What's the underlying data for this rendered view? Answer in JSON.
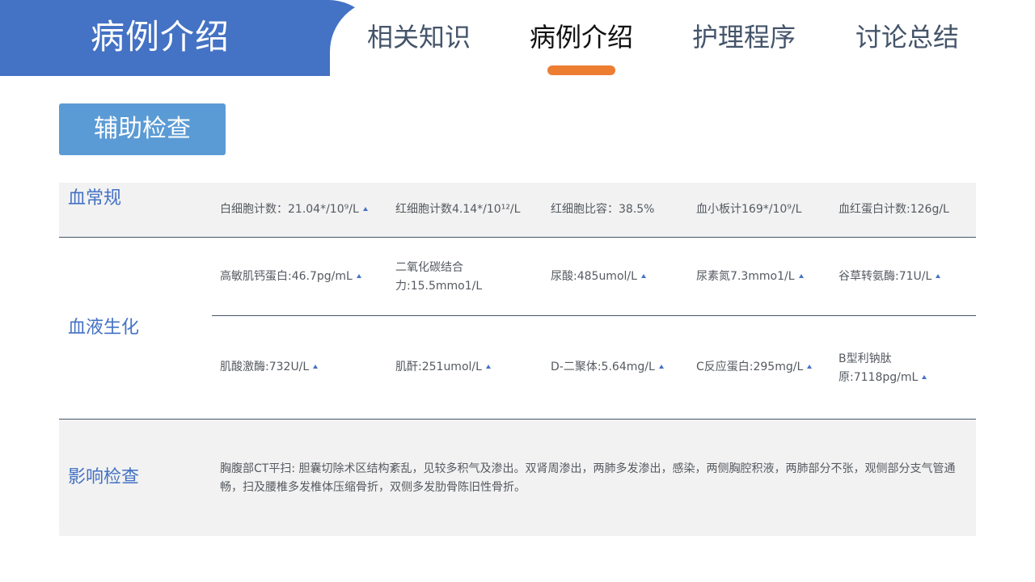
{
  "header": {
    "brand_title": "病例介绍",
    "tabs": [
      {
        "label": "相关知识"
      },
      {
        "label": "病例介绍"
      },
      {
        "label": "护理程序"
      },
      {
        "label": "讨论总结"
      }
    ]
  },
  "section_button": "辅助检查",
  "table": {
    "blood_routine": {
      "category": "血常规",
      "items": [
        "白细胞计数：21.04*/10⁹/L",
        "红细胞计数4.14*/10¹²/L",
        "红细胞比容：38.5%",
        "血小板计169*/10⁹/L",
        "血红蛋白计数:126g/L"
      ]
    },
    "biochem": {
      "category": "血液生化",
      "row1": [
        "高敏肌钙蛋白:46.7pg/mL",
        "二氧化碳结合力:15.5mmo1/L",
        "尿酸:485umol/L",
        "尿素氮7.3mmo1/L",
        "谷草转氨酶:71U/L"
      ],
      "row2": [
        "肌酸激酶:732U/L",
        "肌酐:251umol/L",
        "D-二聚体:5.64mg/L",
        "C反应蛋白:295mg/L",
        "B型利钠肽原:7118pg/mL"
      ]
    },
    "imaging": {
      "category": "影响检查",
      "text": "胸腹部CT平扫: 胆囊切除术区结构紊乱，见较多积气及渗出。双肾周渗出，两肺多发渗出，感染，两侧胸腔积液，两肺部分不张，观侧部分支气管通畅，扫及腰椎多发椎体压缩骨折，双侧多发肋骨陈旧性骨折。"
    }
  },
  "colors": {
    "brand_blue": "#4472c4",
    "button_blue": "#5b9bd5",
    "accent_orange": "#ed7d31",
    "band_gray": "#f2f2f2"
  },
  "icons": {
    "marker": "small-up-triangle-icon"
  }
}
